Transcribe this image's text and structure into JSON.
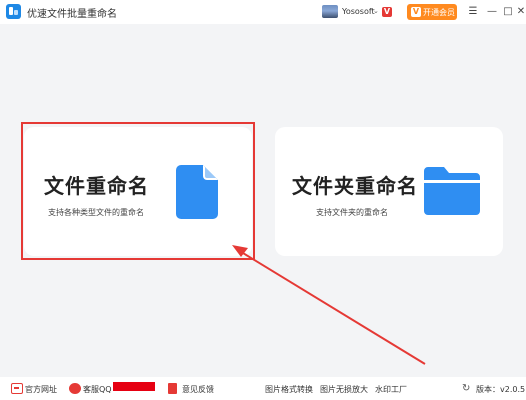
{
  "titlebar": {
    "app_title": "优速文件批量重命名",
    "username": "Yososoft",
    "user_chevron": "⌄",
    "user_badge": "V",
    "vip_icon": "V",
    "vip_label": "开通会员",
    "menu_glyph": "☰",
    "minimize_glyph": "—",
    "maximize_glyph": "□",
    "close_glyph": "✕"
  },
  "cards": {
    "file": {
      "title": "文件重命名",
      "description": "支持各种类型文件的重命名",
      "icon": "file-icon"
    },
    "folder": {
      "title": "文件夹重命名",
      "description": "支持文件夹的重命名",
      "icon": "folder-icon"
    }
  },
  "footer": {
    "website": "官方网址",
    "qq": "客服QQ",
    "feedback": "意见反馈",
    "image_convert": "图片格式转换",
    "image_enlarge": "图片无损放大",
    "watermark": "水印工厂",
    "version_icon": "↻",
    "version": "版本：v2.0.5"
  },
  "colors": {
    "accent_blue": "#2f8ef2",
    "vip_orange": "#ff8a1f",
    "annotation_red": "#e53935",
    "background": "#f3f4f6"
  }
}
